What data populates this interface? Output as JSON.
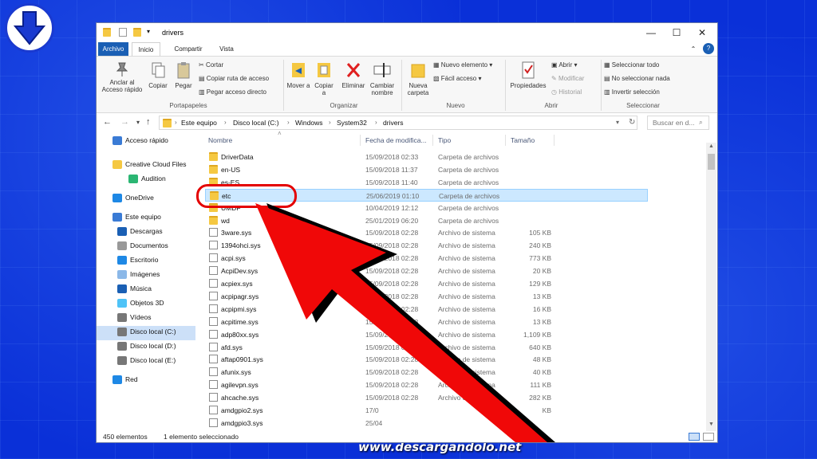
{
  "window": {
    "title": "drivers",
    "controls": {
      "minimize": "—",
      "maximize": "☐",
      "close": "✕"
    },
    "help": "?"
  },
  "tabs": [
    "Archivo",
    "Inicio",
    "Compartir",
    "Vista"
  ],
  "ribbon": {
    "portapapeles": {
      "pin": "Anclar al Acceso rápido",
      "copy": "Copiar",
      "paste": "Pegar",
      "cut": "Cortar",
      "copy_path": "Copiar ruta de acceso",
      "paste_shortcut": "Pegar acceso directo",
      "label": "Portapapeles"
    },
    "organizar": {
      "move": "Mover a",
      "copy_to": "Copiar a",
      "delete": "Eliminar",
      "rename": "Cambiar nombre",
      "label": "Organizar"
    },
    "nuevo": {
      "new_folder": "Nueva carpeta",
      "new_item": "Nuevo elemento",
      "easy_access": "Fácil acceso",
      "label": "Nuevo"
    },
    "abrir": {
      "properties": "Propiedades",
      "open": "Abrir",
      "edit": "Modificar",
      "history": "Historial",
      "label": "Abrir"
    },
    "seleccionar": {
      "select_all": "Seleccionar todo",
      "select_none": "No seleccionar nada",
      "invert": "Invertir selección",
      "label": "Seleccionar"
    }
  },
  "address": {
    "crumbs": [
      "Este equipo",
      "Disco local (C:)",
      "Windows",
      "System32",
      "drivers"
    ],
    "search_placeholder": "Buscar en d..."
  },
  "nav": [
    {
      "label": "Acceso rápido",
      "icon": "star-icon"
    },
    {
      "label": "Creative Cloud Files",
      "icon": "folder-icon"
    },
    {
      "label": "Audition",
      "icon": "audition-icon"
    },
    {
      "label": "OneDrive",
      "icon": "cloud-icon"
    },
    {
      "label": "Este equipo",
      "icon": "computer-icon"
    },
    {
      "label": "Descargas",
      "icon": "download-icon"
    },
    {
      "label": "Documentos",
      "icon": "documents-icon"
    },
    {
      "label": "Escritorio",
      "icon": "desktop-icon"
    },
    {
      "label": "Imágenes",
      "icon": "images-icon"
    },
    {
      "label": "Música",
      "icon": "music-icon"
    },
    {
      "label": "Objetos 3D",
      "icon": "cube-icon"
    },
    {
      "label": "Vídeos",
      "icon": "video-icon"
    },
    {
      "label": "Disco local (C:)",
      "icon": "drive-icon"
    },
    {
      "label": "Disco local (D:)",
      "icon": "drive-icon"
    },
    {
      "label": "Disco local (E:)",
      "icon": "drive-icon"
    },
    {
      "label": "Red",
      "icon": "network-icon"
    }
  ],
  "columns": {
    "name": "Nombre",
    "date": "Fecha de modifica...",
    "type": "Tipo",
    "size": "Tamaño"
  },
  "files": [
    {
      "name": "DriverData",
      "date": "15/09/2018 02:33",
      "type": "Carpeta de archivos",
      "size": "",
      "kind": "folder"
    },
    {
      "name": "en-US",
      "date": "15/09/2018 11:37",
      "type": "Carpeta de archivos",
      "size": "",
      "kind": "folder"
    },
    {
      "name": "es-ES",
      "date": "15/09/2018 11:40",
      "type": "Carpeta de archivos",
      "size": "",
      "kind": "folder"
    },
    {
      "name": "etc",
      "date": "25/06/2019 01:10",
      "type": "Carpeta de archivos",
      "size": "",
      "kind": "folder"
    },
    {
      "name": "UMDF",
      "date": "10/04/2019 12:12",
      "type": "Carpeta de archivos",
      "size": "",
      "kind": "folder"
    },
    {
      "name": "wd",
      "date": "25/01/2019 06:20",
      "type": "Carpeta de archivos",
      "size": "",
      "kind": "folder"
    },
    {
      "name": "3ware.sys",
      "date": "15/09/2018 02:28",
      "type": "Archivo de sistema",
      "size": "105 KB",
      "kind": "sys"
    },
    {
      "name": "1394ohci.sys",
      "date": "15/09/2018 02:28",
      "type": "Archivo de sistema",
      "size": "240 KB",
      "kind": "sys"
    },
    {
      "name": "acpi.sys",
      "date": "15/09/2018 02:28",
      "type": "Archivo de sistema",
      "size": "773 KB",
      "kind": "sys"
    },
    {
      "name": "AcpiDev.sys",
      "date": "15/09/2018 02:28",
      "type": "Archivo de sistema",
      "size": "20 KB",
      "kind": "sys"
    },
    {
      "name": "acpiex.sys",
      "date": "15/09/2018 02:28",
      "type": "Archivo de sistema",
      "size": "129 KB",
      "kind": "sys"
    },
    {
      "name": "acpipagr.sys",
      "date": "15/09/2018 02:28",
      "type": "Archivo de sistema",
      "size": "13 KB",
      "kind": "sys"
    },
    {
      "name": "acpipmi.sys",
      "date": "15/09/2018 02:28",
      "type": "Archivo de sistema",
      "size": "16 KB",
      "kind": "sys"
    },
    {
      "name": "acpitime.sys",
      "date": "15/09/2018 02:28",
      "type": "Archivo de sistema",
      "size": "13 KB",
      "kind": "sys"
    },
    {
      "name": "adp80xx.sys",
      "date": "15/09/2018 02:28",
      "type": "Archivo de sistema",
      "size": "1,109 KB",
      "kind": "sys"
    },
    {
      "name": "afd.sys",
      "date": "15/09/2018 02:28",
      "type": "Archivo de sistema",
      "size": "640 KB",
      "kind": "sys"
    },
    {
      "name": "aftap0901.sys",
      "date": "15/09/2018 02:28",
      "type": "Archivo de sistema",
      "size": "48 KB",
      "kind": "sys"
    },
    {
      "name": "afunix.sys",
      "date": "15/09/2018 02:28",
      "type": "Archivo de sistema",
      "size": "40 KB",
      "kind": "sys"
    },
    {
      "name": "agilevpn.sys",
      "date": "15/09/2018 02:28",
      "type": "Archivo de sistema",
      "size": "111 KB",
      "kind": "sys"
    },
    {
      "name": "ahcache.sys",
      "date": "15/09/2018 02:28",
      "type": "Archivo de sistema",
      "size": "282 KB",
      "kind": "sys"
    },
    {
      "name": "amdgpio2.sys",
      "date": "17/0",
      "type": "",
      "size": "KB",
      "kind": "sys"
    },
    {
      "name": "amdgpio3.sys",
      "date": "25/04",
      "type": "",
      "size": "",
      "kind": "sys"
    }
  ],
  "status": {
    "count": "450 elementos",
    "selected": "1 elemento seleccionado"
  },
  "watermark": "www.descargandolo.net",
  "colors": {
    "accent": "#1a5fb4",
    "highlight": "#e40000",
    "background": "#0a30d8"
  }
}
